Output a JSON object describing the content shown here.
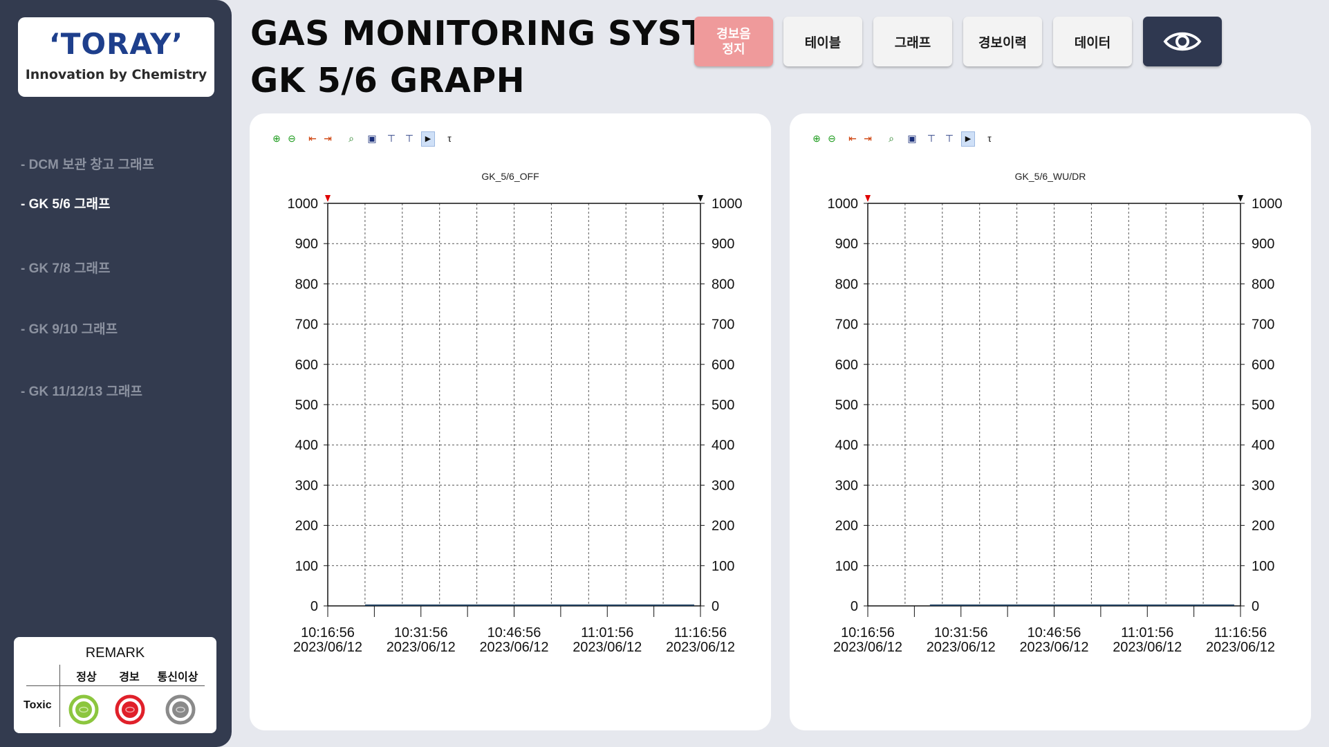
{
  "app": {
    "title_line1": "GAS MONITORING SYSTEM",
    "title_line2": "GK 5/6 GRAPH"
  },
  "logo": {
    "brand": "ʻTORAYʼ",
    "tagline": "Innovation by Chemistry"
  },
  "sidebar": {
    "items": [
      {
        "label": "- DCM 보관 창고 그래프",
        "active": false
      },
      {
        "label": "- GK 5/6 그래프",
        "active": true
      },
      {
        "label": "- GK 7/8 그래프",
        "active": false
      },
      {
        "label": "- GK 9/10 그래프",
        "active": false
      },
      {
        "label": "- GK 11/12/13 그래프",
        "active": false
      }
    ]
  },
  "remark": {
    "title": "REMARK",
    "columns": [
      "정상",
      "경보",
      "통신이상"
    ],
    "row_label": "Toxic",
    "colors": {
      "normal": "#8cc63e",
      "alarm": "#e0202a",
      "comm_error": "#8a8a8a"
    }
  },
  "toolbar": {
    "alarm_stop": "경보음\n정지",
    "table": "테이블",
    "graph": "그래프",
    "alarm_history": "경보이력",
    "data": "데이터",
    "eye_icon": "eye-icon"
  },
  "chart_toolbar_icons": [
    "zoom-in-icon",
    "zoom-out-icon",
    "scroll-left-icon",
    "scroll-right-icon",
    "search-icon",
    "save-icon",
    "cursor-left-icon",
    "cursor-right-icon",
    "play-icon",
    "tau-icon"
  ],
  "chart_data": [
    {
      "type": "line",
      "title": "GK_5/6_OFF",
      "ylim": [
        0,
        1000
      ],
      "yticks": [
        0,
        100,
        200,
        300,
        400,
        500,
        600,
        700,
        800,
        900,
        1000
      ],
      "x_tick_labels": [
        {
          "time": "10:16:56",
          "date": "2023/06/12"
        },
        {
          "time": "10:31:56",
          "date": "2023/06/12"
        },
        {
          "time": "10:46:56",
          "date": "2023/06/12"
        },
        {
          "time": "11:01:56",
          "date": "2023/06/12"
        },
        {
          "time": "11:16:56",
          "date": "2023/06/12"
        }
      ],
      "grid": true,
      "series": [
        {
          "x": [
            "10:22:56",
            "11:15:56"
          ],
          "values": [
            0,
            0
          ],
          "color": "#1f3f5f"
        }
      ]
    },
    {
      "type": "line",
      "title": "GK_5/6_WU/DR",
      "ylim": [
        0,
        1000
      ],
      "yticks": [
        0,
        100,
        200,
        300,
        400,
        500,
        600,
        700,
        800,
        900,
        1000
      ],
      "x_tick_labels": [
        {
          "time": "10:16:56",
          "date": "2023/06/12"
        },
        {
          "time": "10:31:56",
          "date": "2023/06/12"
        },
        {
          "time": "10:46:56",
          "date": "2023/06/12"
        },
        {
          "time": "11:01:56",
          "date": "2023/06/12"
        },
        {
          "time": "11:16:56",
          "date": "2023/06/12"
        }
      ],
      "grid": true,
      "series": [
        {
          "x": [
            "10:26:56",
            "11:15:56"
          ],
          "values": [
            0,
            0
          ],
          "color": "#1f3f5f"
        }
      ]
    }
  ]
}
